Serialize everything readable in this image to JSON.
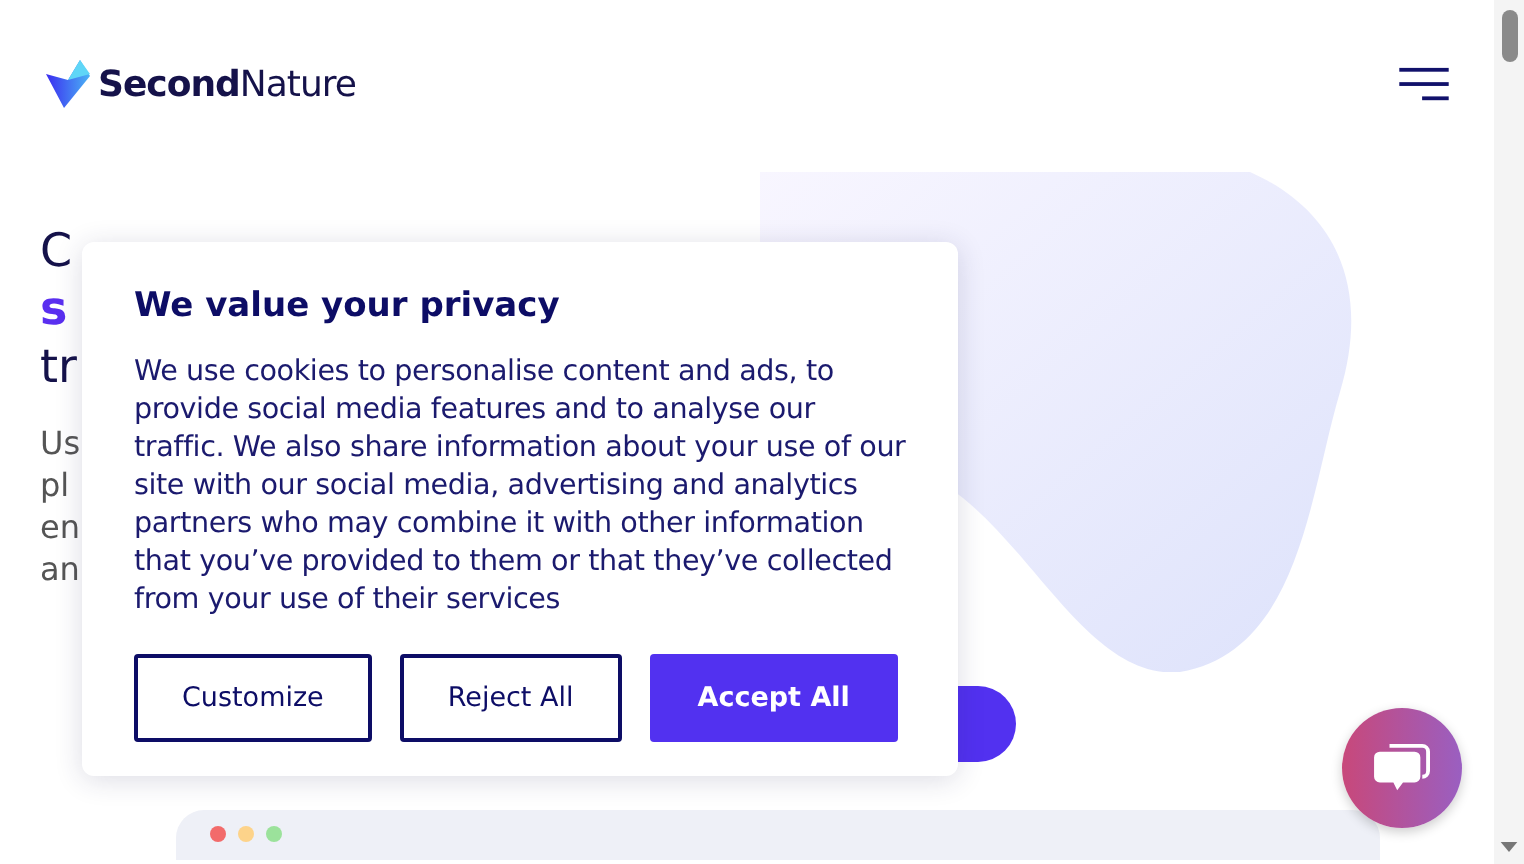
{
  "header": {
    "logo_bold": "Second",
    "logo_light": "Nature"
  },
  "hero": {
    "heading_lines": [
      {
        "text": "C",
        "kind": "plain"
      },
      {
        "text": "s",
        "kind": "accent"
      },
      {
        "text": "tr",
        "kind": "plain"
      }
    ],
    "paragraph_lines": [
      "Us",
      "pl",
      "en",
      "an"
    ]
  },
  "cookie_banner": {
    "title": "We value your privacy",
    "body": "We use cookies to personalise content and ads, to provide social media features and to analyse our traffic. We also share information about your use of our site with our social media, advertising and analytics partners who may combine it with other information that you’ve provided to them or that they’ve collected from your use of their services",
    "buttons": [
      {
        "label": "Customize",
        "kind": "outline"
      },
      {
        "label": "Reject All",
        "kind": "outline"
      },
      {
        "label": "Accept All",
        "kind": "primary"
      }
    ]
  }
}
